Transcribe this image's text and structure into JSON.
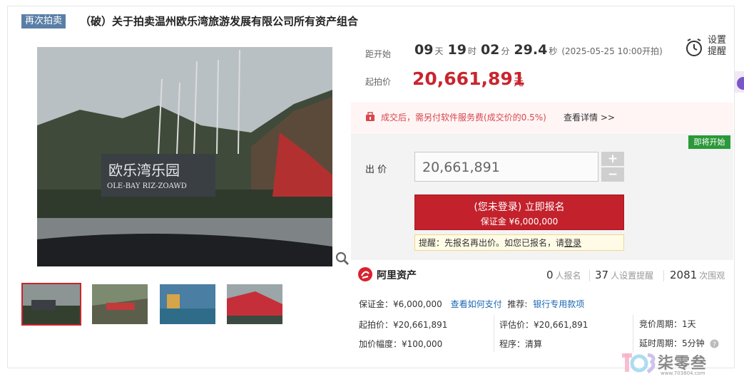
{
  "header": {
    "tag": "再次拍卖",
    "title": "（破）关于拍卖温州欧乐湾旅游发展有限公司所有资产组合"
  },
  "countdown": {
    "label": "距开始",
    "days": "09",
    "days_unit": "天",
    "hours": "19",
    "hours_unit": "时",
    "minutes": "02",
    "minutes_unit": "分",
    "seconds": "29.4",
    "seconds_unit": "秒",
    "start_note": "(2025-05-25 10:00开拍)"
  },
  "reminder": {
    "label_line1": "设置",
    "label_line2": "提醒",
    "icon": "alarm-clock-icon"
  },
  "start_price": {
    "label": "起拍价",
    "value": "20,661,891",
    "unit": "元"
  },
  "notice": {
    "text": "成交后，需另付软件服务费(成交价的0.5%)",
    "link": "查看详情 >>"
  },
  "bid": {
    "badge": "即将开始",
    "label": "出 价",
    "input_value": "20,661,891",
    "plus": "+",
    "minus": "−",
    "register_line1": "(您未登录) 立即报名",
    "register_line2": "保证金 ¥6,000,000",
    "tip_prefix": "提醒：先报名再出价。如您已报名，请",
    "tip_link": "登录"
  },
  "image_caption": "欧乐湾乐园",
  "image_caption_en": "OLE-BAY RIZ-ZOAWD",
  "provider": {
    "name": "阿里资产"
  },
  "stats": [
    {
      "num": "0",
      "label": "人报名"
    },
    {
      "num": "37",
      "label": "人设置提醒"
    },
    {
      "num": "2081",
      "label": "次围观"
    }
  ],
  "details": {
    "deposit_label": "保证金：",
    "deposit_value": "¥6,000,000",
    "pay_link": "查看如何支付",
    "recommend_label": "推荐:",
    "recommend_link": "银行专用款项",
    "start_label": "起拍价：",
    "start_value": "¥20,661,891",
    "appraisal_label": "评估价：",
    "appraisal_value": "¥20,661,891",
    "cycle_label": "竞价周期：",
    "cycle_value": "1天",
    "increment_label": "加价幅度：",
    "increment_value": "¥100,000",
    "procedure_label": "程序：",
    "procedure_value": "清算",
    "delay_label": "延时周期：",
    "delay_value": "5分钟"
  },
  "watermark": {
    "brand": "柒零叁",
    "url": "www.703804.com"
  },
  "colors": {
    "accent_red": "#c9252e",
    "tag_blue": "#5a7fa6",
    "badge_green": "#2b9939",
    "link_blue": "#1a67b3"
  }
}
